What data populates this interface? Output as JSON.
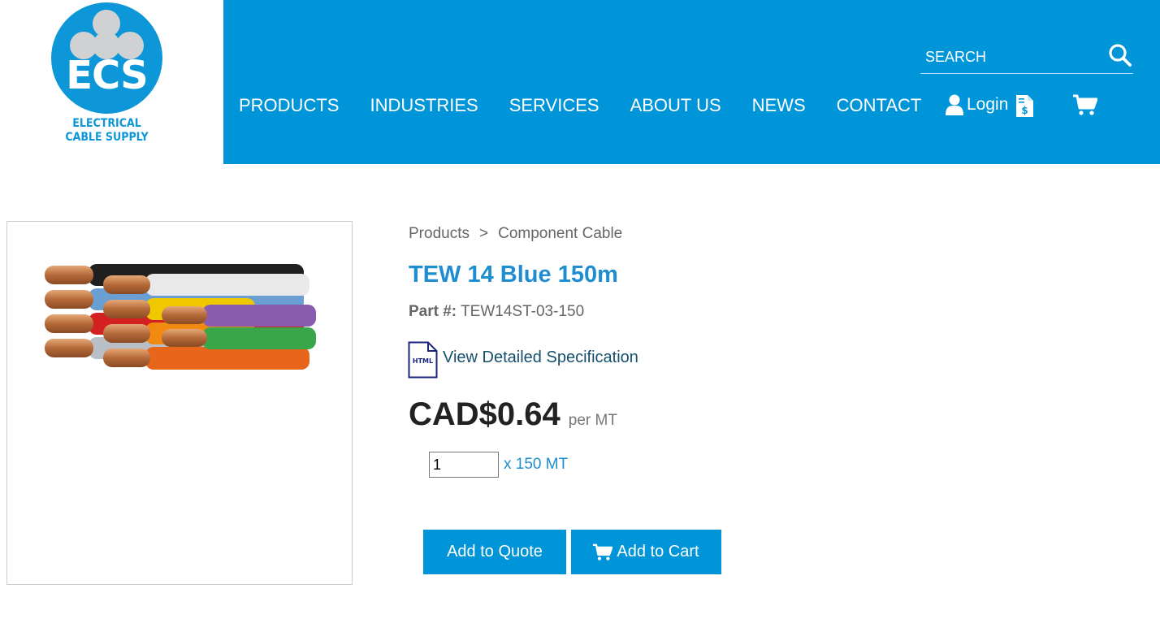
{
  "logo": {
    "mark": "ECS",
    "line1": "ELECTRICAL",
    "line2": "CABLE SUPPLY"
  },
  "nav": [
    "PRODUCTS",
    "INDUSTRIES",
    "SERVICES",
    "ABOUT US",
    "NEWS",
    "CONTACT"
  ],
  "header": {
    "search_placeholder": "SEARCH",
    "login_label": "Login",
    "icons": [
      "search-icon",
      "user-icon",
      "quote-document-icon",
      "cart-icon"
    ]
  },
  "breadcrumb": [
    "Products",
    "Component Cable"
  ],
  "product": {
    "title": "TEW 14 Blue 150m",
    "part_label": "Part #:",
    "part_number": "TEW14ST-03-150",
    "spec_icon_text": "HTML",
    "spec_link": "View Detailed Specification",
    "price": "CAD$0.64",
    "price_unit": "per MT",
    "quantity": "1",
    "quantity_unit": "x 150 MT",
    "wire_colors": [
      "#1f1f1f",
      "#e9e9e9",
      "#6a9fd4",
      "#f0c800",
      "#8a5cb0",
      "#d32020",
      "#f08a10",
      "#3aa64a",
      "#b8bfc6",
      "#e8651c"
    ]
  },
  "actions": {
    "quote": "Add to Quote",
    "cart": "Add to Cart"
  },
  "colors": {
    "brand_blue": "#0095d9",
    "title_blue": "#1e8ed0",
    "logo_gray": "#cfd1d3"
  }
}
